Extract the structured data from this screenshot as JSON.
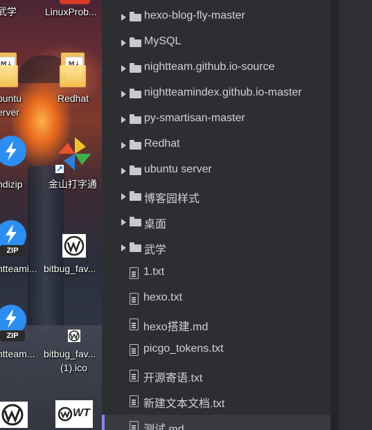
{
  "desktop": {
    "icons": [
      {
        "label": "武学",
        "kind": "folder"
      },
      {
        "label": "LinuxProb...",
        "kind": "app"
      },
      {
        "label": "buntu",
        "label2": "erver",
        "kind": "folder-md"
      },
      {
        "label": "Redhat",
        "kind": "folder-md"
      },
      {
        "label": "ndizip",
        "kind": "bandizip"
      },
      {
        "label": "金山打字通",
        "kind": "app"
      },
      {
        "label": "htteami...",
        "kind": "zip"
      },
      {
        "label": "bitbug_fav...",
        "kind": "image"
      },
      {
        "label": "htteam...",
        "kind": "zip"
      },
      {
        "label": "bitbug_fav...",
        "label2": "(1).ico",
        "kind": "ico"
      },
      {
        "label": "",
        "kind": "image"
      },
      {
        "label": "",
        "kind": "wt-logo"
      }
    ],
    "zip_badge": "ZIP",
    "folder_md_badge": "M↓",
    "wt_text": "WT"
  },
  "file_tree": {
    "folders": [
      "hexo-blog-fly-master",
      "MySQL",
      "nightteam.github.io-source",
      "nightteamindex.github.io-master",
      "py-smartisan-master",
      "Redhat",
      "ubuntu server",
      "博客园样式",
      "桌面",
      "武学"
    ],
    "files": [
      "1.txt",
      "hexo.txt",
      "hexo搭建.md",
      "picgo_tokens.txt",
      "开源寄语.txt",
      "新建文本文档.txt",
      "测试.md"
    ],
    "selected_file": "测试.md"
  },
  "colors": {
    "tree_bg": "#2d2e32",
    "text": "#d2d2d6",
    "selection_accent": "#8f84e8"
  }
}
